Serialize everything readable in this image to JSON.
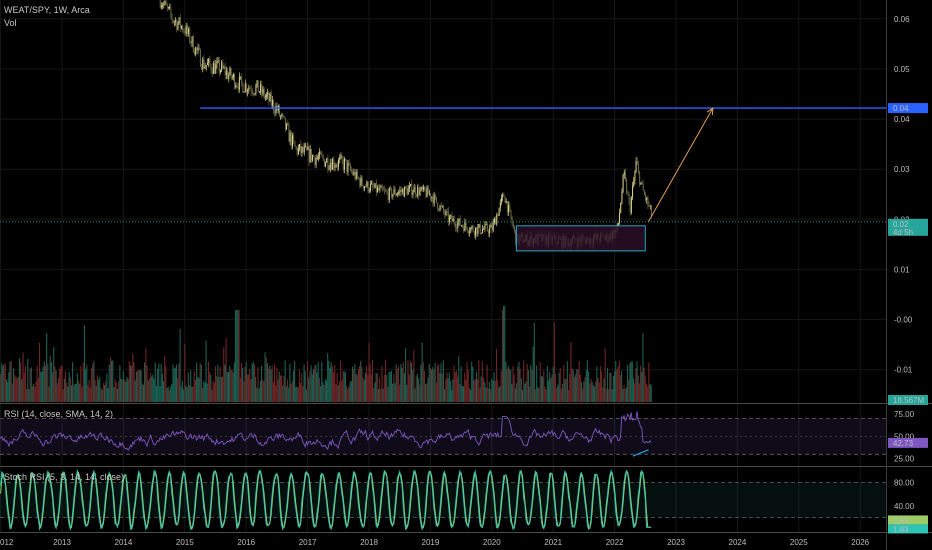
{
  "header": {
    "symbol": "WEAT/SPY, 1W, Arca",
    "volume_label": "Vol",
    "rsi_label": "RSI (14, close, SMA, 14, 2)",
    "stoch_label": "Stoch RSI (5, 3, 14, 14, close)"
  },
  "colors": {
    "background": "#000000",
    "up": "#d9d08a",
    "down": "#6b6b4a",
    "volume_up": "#1f6b5c",
    "volume_down": "#7a2a2a",
    "hline": "#2962ff",
    "arrow": "#e0a050",
    "box_border": "#26a6c6",
    "box_fill": "#2a0f26",
    "rsi_line": "#7e57c2",
    "stoch_k": "#2ec4b6",
    "stoch_d": "#9ccc65",
    "price_tag": "#26a69a",
    "level_tag": "#2962ff"
  },
  "chart_data": [
    {
      "type": "candlestick",
      "x_ticks": [
        "012",
        "2013",
        "2014",
        "2015",
        "2016",
        "2017",
        "2018",
        "2019",
        "2020",
        "2021",
        "2022",
        "2023",
        "2024",
        "2025",
        "2026"
      ],
      "y_ticks": [
        "0.06",
        "0.05",
        "0.04",
        "0.03",
        "0.02",
        "0.01",
        "-0.00",
        "-0.01"
      ],
      "ylim": [
        -0.017,
        0.064
      ],
      "approx_close_path": [
        {
          "x": 2014.6,
          "y": 0.064
        },
        {
          "x": 2014.8,
          "y": 0.06
        },
        {
          "x": 2015.0,
          "y": 0.058
        },
        {
          "x": 2015.3,
          "y": 0.051
        },
        {
          "x": 2015.6,
          "y": 0.05
        },
        {
          "x": 2015.9,
          "y": 0.047
        },
        {
          "x": 2016.2,
          "y": 0.046
        },
        {
          "x": 2016.5,
          "y": 0.042
        },
        {
          "x": 2016.8,
          "y": 0.034
        },
        {
          "x": 2017.2,
          "y": 0.032
        },
        {
          "x": 2017.6,
          "y": 0.031
        },
        {
          "x": 2017.9,
          "y": 0.027
        },
        {
          "x": 2018.3,
          "y": 0.025
        },
        {
          "x": 2018.7,
          "y": 0.026
        },
        {
          "x": 2019.0,
          "y": 0.025
        },
        {
          "x": 2019.3,
          "y": 0.02
        },
        {
          "x": 2019.7,
          "y": 0.018
        },
        {
          "x": 2020.0,
          "y": 0.018
        },
        {
          "x": 2020.2,
          "y": 0.025
        },
        {
          "x": 2020.4,
          "y": 0.016
        },
        {
          "x": 2020.8,
          "y": 0.016
        },
        {
          "x": 2021.2,
          "y": 0.0155
        },
        {
          "x": 2021.6,
          "y": 0.016
        },
        {
          "x": 2021.9,
          "y": 0.0165
        },
        {
          "x": 2022.05,
          "y": 0.018
        },
        {
          "x": 2022.15,
          "y": 0.029
        },
        {
          "x": 2022.25,
          "y": 0.022
        },
        {
          "x": 2022.35,
          "y": 0.031
        },
        {
          "x": 2022.45,
          "y": 0.026
        },
        {
          "x": 2022.6,
          "y": 0.021
        }
      ],
      "horizontal_level": 0.0422,
      "last_price_label": "0.02",
      "last_price_sub": "4d 5h",
      "level_label": "0.04",
      "volume_label": "18.567M",
      "rectangle": {
        "x": [
          2020.4,
          2022.5
        ],
        "y": [
          0.0137,
          0.0187
        ]
      },
      "arrow": {
        "from": {
          "x": 2022.55,
          "y": 0.0195
        },
        "to": {
          "x": 2023.6,
          "y": 0.0422
        }
      }
    },
    {
      "type": "line",
      "name": "RSI",
      "y_ticks": [
        "75.00",
        "50.00",
        "25.00"
      ],
      "bands": [
        70,
        30
      ],
      "ylim": [
        18,
        85
      ],
      "last_value": "42.73"
    },
    {
      "type": "line",
      "name": "Stoch RSI",
      "y_ticks": [
        "80.00",
        "40.00"
      ],
      "bands": [
        80,
        20
      ],
      "ylim": [
        -5,
        105
      ],
      "last_values": [
        "2.55",
        "1.83"
      ]
    }
  ]
}
